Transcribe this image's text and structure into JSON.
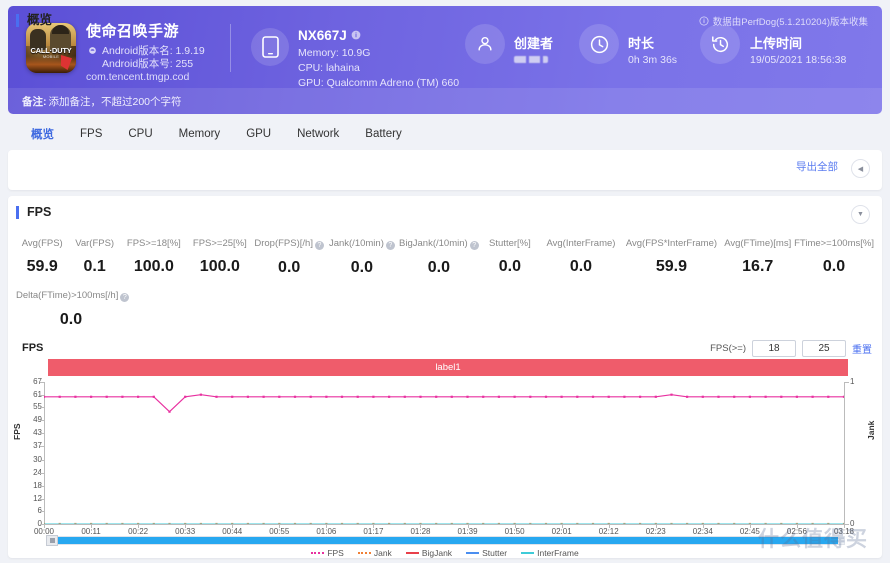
{
  "header": {
    "app_name": "使命召唤手游",
    "app_icon_text": "CALL·DUTY",
    "app_icon_sub": "MOBILE",
    "android_version_name": "Android版本名: 1.9.19",
    "android_version_code": "Android版本号: 255",
    "package": "com.tencent.tmgp.cod",
    "device_name": "NX667J",
    "device_memory": "Memory: 10.9G",
    "device_cpu": "CPU: lahaina",
    "device_gpu": "GPU: Qualcomm Adreno (TM) 660",
    "creator_label": "创建者",
    "creator_value": "",
    "duration_label": "时长",
    "duration_value": "0h 3m 36s",
    "upload_label": "上传时间",
    "upload_value": "19/05/2021 18:56:38",
    "perfdog_note": "数据由PerfDog(5.1.210204)版本收集",
    "remark_label": "备注:",
    "remark_placeholder": "添加备注，不超过200个字符",
    "accent": "#6a5fe0"
  },
  "tabs": [
    {
      "label": "概览",
      "active": true
    },
    {
      "label": "FPS",
      "active": false
    },
    {
      "label": "CPU",
      "active": false
    },
    {
      "label": "Memory",
      "active": false
    },
    {
      "label": "GPU",
      "active": false
    },
    {
      "label": "Network",
      "active": false
    },
    {
      "label": "Battery",
      "active": false
    }
  ],
  "overview": {
    "title": "概览",
    "export_label": "导出全部",
    "collapse_icon": "◀"
  },
  "fps_section": {
    "title": "FPS",
    "collapse_icon": "▼",
    "chart_label": "FPS",
    "threshold_label": "FPS(>=)",
    "threshold_1": "18",
    "threshold_2": "25",
    "reset_label": "重置",
    "label_bar": "label1"
  },
  "metrics": [
    {
      "label": "Avg(FPS)",
      "value": "59.9",
      "info": false
    },
    {
      "label": "Var(FPS)",
      "value": "0.1",
      "info": false
    },
    {
      "label": "FPS>=18[%]",
      "value": "100.0",
      "info": false
    },
    {
      "label": "FPS>=25[%]",
      "value": "100.0",
      "info": false
    },
    {
      "label": "Drop(FPS)[/h]",
      "value": "0.0",
      "info": true
    },
    {
      "label": "Jank(/10min)",
      "value": "0.0",
      "info": true
    },
    {
      "label": "BigJank(/10min)",
      "value": "0.0",
      "info": true
    },
    {
      "label": "Stutter[%]",
      "value": "0.0",
      "info": false
    },
    {
      "label": "Avg(InterFrame)",
      "value": "0.0",
      "info": false
    },
    {
      "label": "Avg(FPS*InterFrame)",
      "value": "59.9",
      "info": false
    },
    {
      "label": "Avg(FTime)[ms]",
      "value": "16.7",
      "info": false
    },
    {
      "label": "FTime>=100ms[%]",
      "value": "0.0",
      "info": false
    }
  ],
  "metrics_row2": [
    {
      "label": "Delta(FTime)>100ms[/h]",
      "value": "0.0",
      "info": true
    }
  ],
  "chart_data": {
    "type": "line",
    "title": "FPS",
    "xlabel": "",
    "ylabel": "FPS",
    "y2label": "Jank",
    "ylim": [
      0,
      67
    ],
    "y2lim": [
      0,
      1
    ],
    "yticks": [
      0,
      6,
      12,
      18,
      24,
      30,
      37,
      43,
      49,
      55,
      61,
      67
    ],
    "y2ticks": [
      0,
      1
    ],
    "grid": false,
    "legend_position": "bottom",
    "xticks": [
      "00:00",
      "00:11",
      "00:22",
      "00:33",
      "00:44",
      "00:55",
      "01:06",
      "01:17",
      "01:28",
      "01:39",
      "01:50",
      "02:01",
      "02:12",
      "02:23",
      "02:34",
      "02:45",
      "02:56",
      "03:18"
    ],
    "x": [
      "00:00",
      "00:04",
      "00:08",
      "00:12",
      "00:16",
      "00:20",
      "00:22",
      "00:24",
      "00:28",
      "00:32",
      "00:36",
      "00:40",
      "00:44",
      "00:48",
      "00:52",
      "00:56",
      "01:00",
      "01:04",
      "01:08",
      "01:12",
      "01:16",
      "01:20",
      "01:24",
      "01:28",
      "01:32",
      "01:36",
      "01:40",
      "01:44",
      "01:48",
      "01:52",
      "01:56",
      "02:00",
      "02:04",
      "02:08",
      "02:12",
      "02:16",
      "02:20",
      "02:24",
      "02:28",
      "02:32",
      "02:36",
      "02:40",
      "02:44",
      "02:48",
      "02:52",
      "02:56",
      "03:00",
      "03:04",
      "03:08",
      "03:12",
      "03:16",
      "03:18"
    ],
    "series": [
      {
        "name": "FPS",
        "color": "#e831a0",
        "axis": "left",
        "style": "dotted",
        "values": [
          60,
          60,
          60,
          60,
          60,
          60,
          60,
          60,
          53,
          60,
          61,
          60,
          60,
          60,
          60,
          60,
          60,
          60,
          60,
          60,
          60,
          60,
          60,
          60,
          60,
          60,
          60,
          60,
          60,
          60,
          60,
          60,
          60,
          60,
          60,
          60,
          60,
          60,
          60,
          60,
          61,
          60,
          60,
          60,
          60,
          60,
          60,
          60,
          60,
          60,
          60,
          60
        ]
      },
      {
        "name": "Jank",
        "color": "#f08036",
        "axis": "right",
        "style": "dotted",
        "values": [
          0,
          0,
          0,
          0,
          0,
          0,
          0,
          0,
          0,
          0,
          0,
          0,
          0,
          0,
          0,
          0,
          0,
          0,
          0,
          0,
          0,
          0,
          0,
          0,
          0,
          0,
          0,
          0,
          0,
          0,
          0,
          0,
          0,
          0,
          0,
          0,
          0,
          0,
          0,
          0,
          0,
          0,
          0,
          0,
          0,
          0,
          0,
          0,
          0,
          0,
          0,
          0
        ]
      },
      {
        "name": "BigJank",
        "color": "#e8404a",
        "axis": "right",
        "style": "solid",
        "values": [
          0,
          0,
          0,
          0,
          0,
          0,
          0,
          0,
          0,
          0,
          0,
          0,
          0,
          0,
          0,
          0,
          0,
          0,
          0,
          0,
          0,
          0,
          0,
          0,
          0,
          0,
          0,
          0,
          0,
          0,
          0,
          0,
          0,
          0,
          0,
          0,
          0,
          0,
          0,
          0,
          0,
          0,
          0,
          0,
          0,
          0,
          0,
          0,
          0,
          0,
          0,
          0
        ]
      },
      {
        "name": "Stutter",
        "color": "#4a8ef0",
        "axis": "right",
        "style": "solid",
        "values": [
          0,
          0,
          0,
          0,
          0,
          0,
          0,
          0,
          0,
          0,
          0,
          0,
          0,
          0,
          0,
          0,
          0,
          0,
          0,
          0,
          0,
          0,
          0,
          0,
          0,
          0,
          0,
          0,
          0,
          0,
          0,
          0,
          0,
          0,
          0,
          0,
          0,
          0,
          0,
          0,
          0,
          0,
          0,
          0,
          0,
          0,
          0,
          0,
          0,
          0,
          0,
          0
        ]
      },
      {
        "name": "InterFrame",
        "color": "#3ecbd8",
        "axis": "right",
        "style": "solid",
        "values": [
          0,
          0,
          0,
          0,
          0,
          0,
          0,
          0,
          0,
          0,
          0,
          0,
          0,
          0,
          0,
          0,
          0,
          0,
          0,
          0,
          0,
          0,
          0,
          0,
          0,
          0,
          0,
          0,
          0,
          0,
          0,
          0,
          0,
          0,
          0,
          0,
          0,
          0,
          0,
          0,
          0,
          0,
          0,
          0,
          0,
          0,
          0,
          0,
          0,
          0,
          0,
          0
        ]
      }
    ]
  },
  "watermark": "什么值得买"
}
